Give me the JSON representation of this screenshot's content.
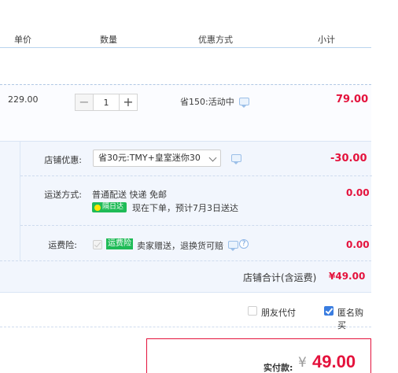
{
  "header": {
    "col_price": "单价",
    "col_qty": "数量",
    "col_discount": "优惠方式",
    "col_subtotal": "小计"
  },
  "item": {
    "price": "229.00",
    "qty_minus": "−",
    "qty_value": "1",
    "qty_plus": "+",
    "promo": "省150:活动中",
    "subtotal": "79.00",
    "chat_icon": "chat-bubble-icon"
  },
  "order": {
    "shop_discount_label": "店铺优惠:",
    "shop_discount_select": "省30元:TMY+皇室迷你30",
    "shop_discount_value": "-30.00",
    "shipping_label": "运送方式:",
    "shipping_method": "普通配送 快递 免邮",
    "shipping_badge": "隔日达",
    "shipping_note": "现在下单，预计7月3日送达",
    "shipping_value": "0.00",
    "insurance_label": "运费险:",
    "insurance_tag": "运费险",
    "insurance_note": "卖家赠送，退换货可赔",
    "insurance_value": "0.00",
    "total_label": "店铺合计(含运费)",
    "total_value": "¥49.00"
  },
  "options": {
    "friend_pay": "朋友代付",
    "friend_pay_checked": false,
    "anonymous": "匿名购买",
    "anonymous_checked": true
  },
  "payment": {
    "label": "实付款:",
    "currency": "¥",
    "amount": "49.00"
  },
  "colors": {
    "accent_red": "#e4123c",
    "badge_green": "#1fbb57",
    "link_blue": "#3a7de0"
  }
}
